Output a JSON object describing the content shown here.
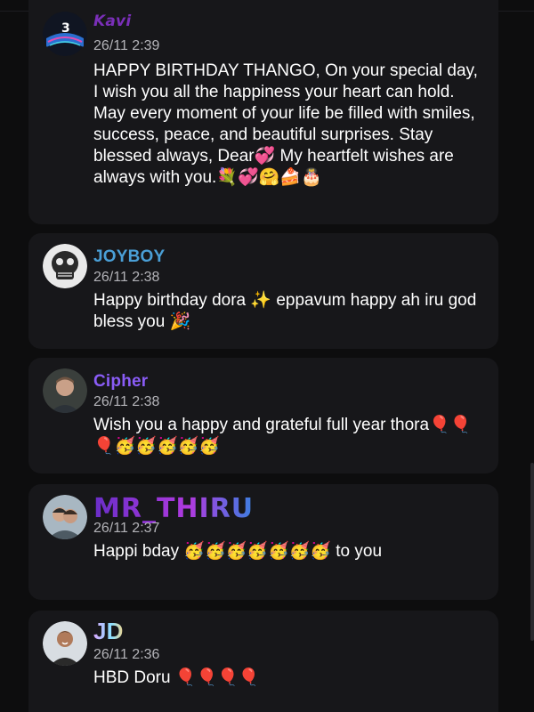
{
  "messages": [
    {
      "username": "Kavi",
      "time": "26/11 2:39",
      "text": "HAPPY BIRTHDAY THANGO, On your special day, I wish you all the happiness your heart can hold. May every moment of your life be filled with smiles, success, peace, and beautiful surprises. Stay blessed always, Dear💞 My heartfelt wishes are always with you.💐💞🤗🍰🎂",
      "avatar_icon": "avatar-graphic"
    },
    {
      "username": "JOYBOY",
      "time": "26/11 2:38",
      "text": "Happy birthday dora ✨ eppavum happy ah iru god bless you 🎉",
      "avatar_icon": "avatar-skull"
    },
    {
      "username": "Cipher",
      "time": "26/11 2:38",
      "text": "Wish you a happy and grateful full year thora🎈🎈🎈🥳🥳🥳🥳🥳",
      "avatar_icon": "avatar-person"
    },
    {
      "username": "MR_THIRU",
      "time": "26/11 2:37",
      "text": "Happi bday 🥳🥳🥳🥳🥳🥳🥳 to you",
      "avatar_icon": "avatar-couple"
    },
    {
      "username": "JD",
      "time": "26/11 2:36",
      "text": "HBD Doru 🎈🎈🎈🎈",
      "avatar_icon": "avatar-person"
    }
  ],
  "colors": {
    "background": "#0d0d0e",
    "card": "#17171a",
    "timestamp": "#b3b3b8",
    "joyboy": "#4a9fd6",
    "cipher": "#8a5cf6"
  }
}
